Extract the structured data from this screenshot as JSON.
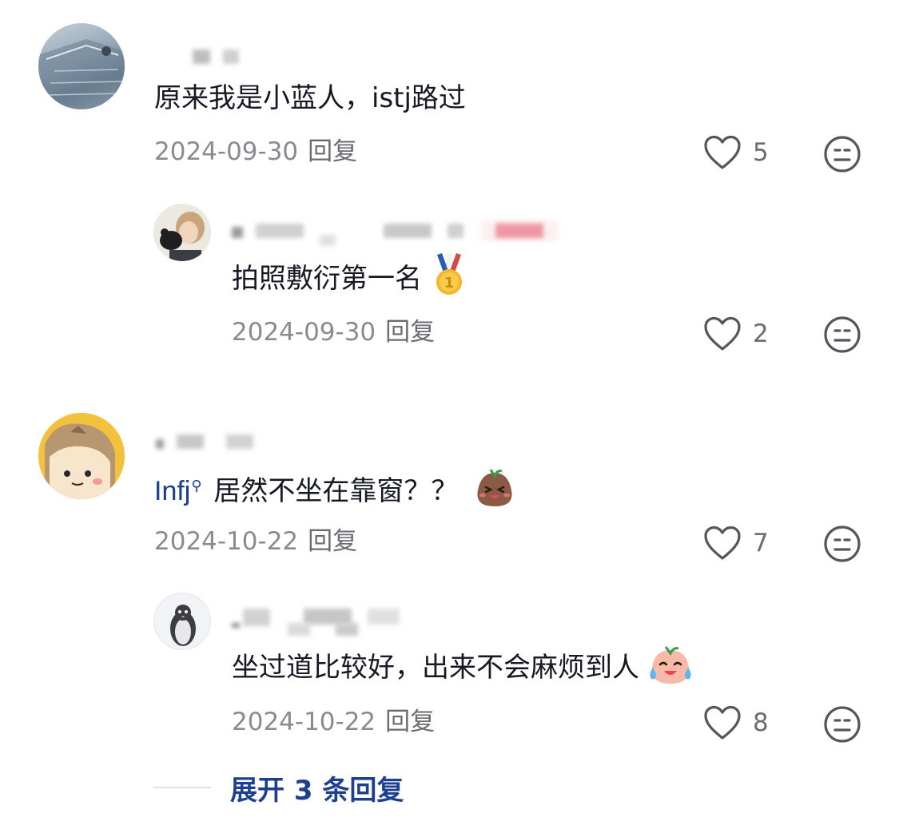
{
  "comments": [
    {
      "text": "原来我是小蓝人，istj路过",
      "date": "2024-09-30",
      "reply_label": "回复",
      "likes": "5",
      "reply": {
        "text": "拍照敷衍第一名",
        "date": "2024-09-30",
        "reply_label": "回复",
        "likes": "2"
      }
    },
    {
      "mbti": "Infj",
      "text": "居然不坐在靠窗？？",
      "date": "2024-10-22",
      "reply_label": "回复",
      "likes": "7",
      "reply": {
        "text": "坐过道比较好，出来不会麻烦到人",
        "date": "2024-10-22",
        "reply_label": "回复",
        "likes": "8"
      }
    }
  ],
  "expand": {
    "label": "展开 3 条回复"
  },
  "icons": {
    "like": "heart-outline-icon",
    "dislike": "meh-face-icon",
    "medal": "gold-medal-icon",
    "laugh_emoji": "cute-laugh-emoji",
    "cry_emoji": "cute-cry-laugh-emoji"
  },
  "colors": {
    "text": "#161823",
    "meta": "#8a8b91",
    "link": "#1d3f8f",
    "background": "#ffffff"
  }
}
